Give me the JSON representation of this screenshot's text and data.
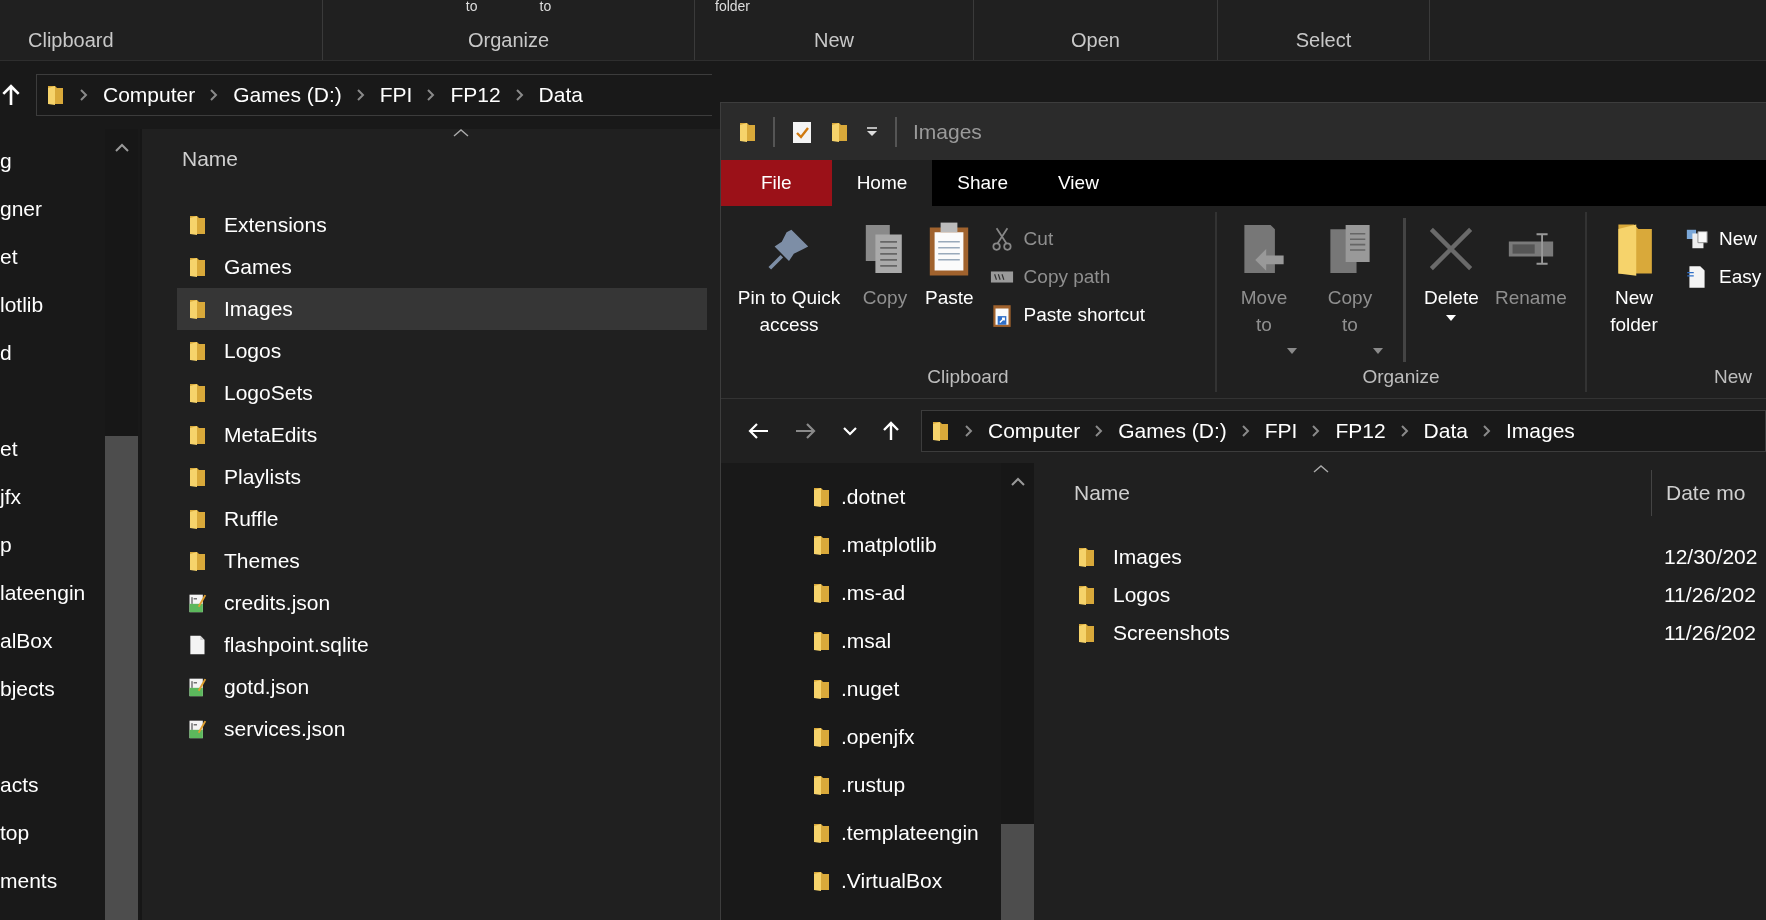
{
  "back_window": {
    "ribbon": {
      "groups": [
        {
          "label": "Clipboard"
        },
        {
          "label": "Organize",
          "top_texts": [
            "to",
            "to"
          ]
        },
        {
          "label": "New",
          "top_texts": [
            "folder"
          ]
        },
        {
          "label": "Open"
        },
        {
          "label": "Select"
        }
      ]
    },
    "address": {
      "crumbs": [
        "Computer",
        "Games (D:)",
        "FPI",
        "FP12",
        "Data"
      ]
    },
    "nav_pane": {
      "items": [
        {
          "label": "g",
          "gap_before": false
        },
        {
          "label": "gner",
          "gap_before": false
        },
        {
          "label": "et",
          "gap_before": false
        },
        {
          "label": "lotlib",
          "gap_before": false
        },
        {
          "label": "d",
          "gap_before": false
        },
        {
          "label": "et",
          "gap_before": true
        },
        {
          "label": "jfx",
          "gap_before": false
        },
        {
          "label": "p",
          "gap_before": false
        },
        {
          "label": "lateengin",
          "gap_before": false
        },
        {
          "label": "alBox",
          "gap_before": false
        },
        {
          "label": "bjects",
          "gap_before": false
        },
        {
          "label": "acts",
          "gap_before": true
        },
        {
          "label": "top",
          "gap_before": false
        },
        {
          "label": "ments",
          "gap_before": false
        }
      ]
    },
    "file_list": {
      "columns": [
        "Name"
      ],
      "rows": [
        {
          "name": "Extensions",
          "kind": "folder",
          "selected": false
        },
        {
          "name": "Games",
          "kind": "folder",
          "selected": false
        },
        {
          "name": "Images",
          "kind": "folder",
          "selected": true
        },
        {
          "name": "Logos",
          "kind": "folder",
          "selected": false
        },
        {
          "name": "LogoSets",
          "kind": "folder",
          "selected": false
        },
        {
          "name": "MetaEdits",
          "kind": "folder",
          "selected": false
        },
        {
          "name": "Playlists",
          "kind": "folder",
          "selected": false
        },
        {
          "name": "Ruffle",
          "kind": "folder",
          "selected": false
        },
        {
          "name": "Themes",
          "kind": "folder",
          "selected": false
        },
        {
          "name": "credits.json",
          "kind": "json",
          "selected": false
        },
        {
          "name": "flashpoint.sqlite",
          "kind": "file",
          "selected": false
        },
        {
          "name": "gotd.json",
          "kind": "json",
          "selected": false
        },
        {
          "name": "services.json",
          "kind": "json",
          "selected": false
        }
      ]
    }
  },
  "front_window": {
    "title": "Images",
    "tabs": [
      {
        "label": "File",
        "kind": "file",
        "selected": false
      },
      {
        "label": "Home",
        "kind": "tab",
        "selected": true
      },
      {
        "label": "Share",
        "kind": "tab",
        "selected": false
      },
      {
        "label": "View",
        "kind": "tab",
        "selected": false
      }
    ],
    "ribbon": {
      "groups": [
        {
          "label": "Clipboard",
          "commands": [
            {
              "kind": "large",
              "label": "Pin to Quick access",
              "disabled": false,
              "has_menu": false
            },
            {
              "kind": "large",
              "label": "Copy",
              "disabled": true,
              "has_menu": false
            },
            {
              "kind": "large",
              "label": "Paste",
              "disabled": false,
              "has_menu": false
            },
            {
              "kind": "small",
              "label": "Cut",
              "disabled": true
            },
            {
              "kind": "small",
              "label": "Copy path",
              "disabled": true
            },
            {
              "kind": "small",
              "label": "Paste shortcut",
              "disabled": false
            }
          ]
        },
        {
          "label": "Organize",
          "commands": [
            {
              "kind": "large",
              "label": "Move to",
              "disabled": true,
              "has_menu": true
            },
            {
              "kind": "large",
              "label": "Copy to",
              "disabled": true,
              "has_menu": true
            },
            {
              "kind": "separator"
            },
            {
              "kind": "large",
              "label": "Delete",
              "disabled": false,
              "has_menu": true
            },
            {
              "kind": "large",
              "label": "Rename",
              "disabled": true,
              "has_menu": false
            }
          ]
        },
        {
          "label": "New",
          "commands": [
            {
              "kind": "large",
              "label": "New folder",
              "disabled": false,
              "has_menu": false
            },
            {
              "kind": "small",
              "label": "New",
              "disabled": false
            },
            {
              "kind": "small",
              "label": "Easy",
              "disabled": false
            }
          ]
        }
      ]
    },
    "address": {
      "crumbs": [
        "Computer",
        "Games (D:)",
        "FPI",
        "FP12",
        "Data",
        "Images"
      ]
    },
    "nav_pane": {
      "items": [
        ".dotnet",
        ".matplotlib",
        ".ms-ad",
        ".msal",
        ".nuget",
        ".openjfx",
        ".rustup",
        ".templateengin",
        ".VirtualBox"
      ]
    },
    "file_list": {
      "columns": [
        "Name",
        "Date mo"
      ],
      "rows": [
        {
          "name": "Images",
          "date": "12/30/202"
        },
        {
          "name": "Logos",
          "date": "11/26/202"
        },
        {
          "name": "Screenshots",
          "date": "11/26/202"
        }
      ]
    }
  }
}
